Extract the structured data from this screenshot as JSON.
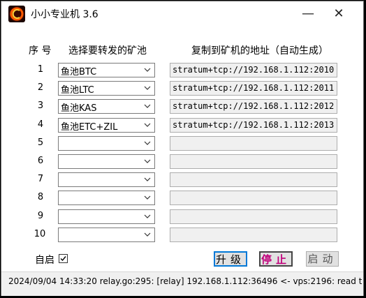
{
  "window": {
    "title": "小小专业机 3.6",
    "min_glyph": "—",
    "close_glyph": "✕"
  },
  "headers": {
    "col_index": "序 号",
    "col_pool": "选择要转发的矿池",
    "col_address": "复制到矿机的地址（自动生成）"
  },
  "rows": [
    {
      "num": "1",
      "pool": "鱼池BTC",
      "address": "stratum+tcp://192.168.1.112:2010"
    },
    {
      "num": "2",
      "pool": "鱼池LTC",
      "address": "stratum+tcp://192.168.1.112:2011"
    },
    {
      "num": "3",
      "pool": "鱼池KAS",
      "address": "stratum+tcp://192.168.1.112:2012"
    },
    {
      "num": "4",
      "pool": "鱼池ETC+ZIL",
      "address": "stratum+tcp://192.168.1.112:2013"
    },
    {
      "num": "5",
      "pool": "",
      "address": ""
    },
    {
      "num": "6",
      "pool": "",
      "address": ""
    },
    {
      "num": "7",
      "pool": "",
      "address": ""
    },
    {
      "num": "8",
      "pool": "",
      "address": ""
    },
    {
      "num": "9",
      "pool": "",
      "address": ""
    },
    {
      "num": "10",
      "pool": "",
      "address": ""
    }
  ],
  "autostart": {
    "label": "自启",
    "checked": true
  },
  "buttons": {
    "upgrade": "升级",
    "stop": "停止",
    "start": "启动"
  },
  "status": {
    "text": "2024/09/04 14:33:20 relay.go:295: [relay] 192.168.1.112:36496 <- vps:2196: read tc"
  },
  "colors": {
    "stop_text": "#c1007b",
    "upgrade_border": "#0078d7",
    "field_bg": "#f0f0f0"
  },
  "icons": {
    "app": "app-logo-icon",
    "dropdown": "chevron-down-icon",
    "check": "checkmark-icon"
  }
}
